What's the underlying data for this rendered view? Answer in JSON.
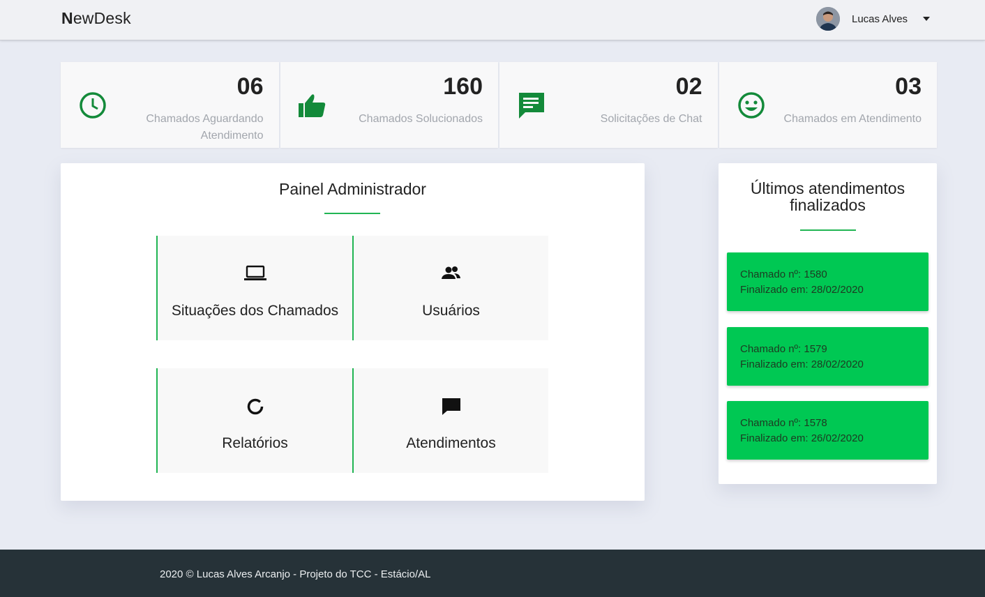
{
  "header": {
    "brand_first": "N",
    "brand_rest": "ewDesk",
    "user_name": "Lucas Alves"
  },
  "stats": [
    {
      "value": "06",
      "label": "Chamados Aguardando Atendimento",
      "icon": "clock-icon"
    },
    {
      "value": "160",
      "label": "Chamados Solucionados",
      "icon": "thumb-up-icon"
    },
    {
      "value": "02",
      "label": "Solicitações de Chat",
      "icon": "chat-icon"
    },
    {
      "value": "03",
      "label": "Chamados em Atendimento",
      "icon": "smiley-icon"
    }
  ],
  "admin": {
    "title": "Painel Administrador",
    "tiles": [
      {
        "label": "Situações dos Chamados",
        "icon": "laptop-icon"
      },
      {
        "label": "Usuários",
        "icon": "users-icon"
      },
      {
        "label": "Relatórios",
        "icon": "donut-chart-icon"
      },
      {
        "label": "Atendimentos",
        "icon": "message-icon"
      }
    ]
  },
  "recent": {
    "title": "Últimos atendimentos finalizados",
    "items": [
      {
        "line1": "Chamado nº: 1580",
        "line2": "Finalizado em: 28/02/2020"
      },
      {
        "line1": "Chamado nº: 1579",
        "line2": "Finalizado em: 28/02/2020"
      },
      {
        "line1": "Chamado nº: 1578",
        "line2": "Finalizado em: 26/02/2020"
      }
    ]
  },
  "footer": {
    "text": "2020 © Lucas Alves Arcanjo - Projeto do TCC - Estácio/AL"
  },
  "colors": {
    "accent_green": "#21b553",
    "icon_green": "#138a3a",
    "ticket_green": "#00c853",
    "footer_bg": "#263238"
  }
}
